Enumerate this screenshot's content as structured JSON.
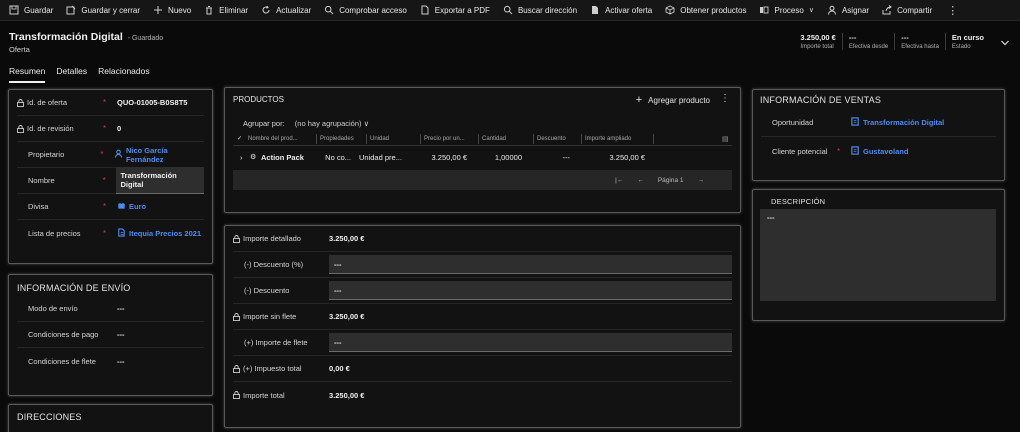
{
  "toolbar": {
    "items": [
      {
        "label": "Guardar",
        "icon": "save-icon"
      },
      {
        "label": "Guardar y cerrar",
        "icon": "save-close-icon"
      },
      {
        "label": "Nuevo",
        "icon": "plus-icon"
      },
      {
        "label": "Eliminar",
        "icon": "trash-icon"
      },
      {
        "label": "Actualizar",
        "icon": "refresh-icon"
      },
      {
        "label": "Comprobar acceso",
        "icon": "search-icon"
      },
      {
        "label": "Exportar a PDF",
        "icon": "export-icon"
      },
      {
        "label": "Buscar dirección",
        "icon": "search-icon"
      },
      {
        "label": "Activar oferta",
        "icon": "document-icon"
      },
      {
        "label": "Obtener productos",
        "icon": "box-icon"
      },
      {
        "label": "Proceso",
        "icon": "process-icon"
      },
      {
        "label": "Asignar",
        "icon": "person-icon"
      },
      {
        "label": "Compartir",
        "icon": "share-icon"
      }
    ],
    "more": "⋮"
  },
  "header": {
    "title": "Transformación Digital",
    "saved": "- Guardado",
    "entity": "Oferta",
    "fields": [
      {
        "value": "3.250,00 €",
        "label": "Importe total"
      },
      {
        "value": "---",
        "label": "Efectiva desde"
      },
      {
        "value": "---",
        "label": "Efectiva hasta"
      },
      {
        "value": "En curso",
        "label": "Estado"
      }
    ]
  },
  "tabs": [
    "Resumen",
    "Detalles",
    "Relacionados"
  ],
  "summary": {
    "fields": [
      {
        "label": "Id. de oferta",
        "value": "QUO-01005-B0S8T5",
        "locked": true,
        "required": true
      },
      {
        "label": "Id. de revisión",
        "value": "0",
        "locked": true,
        "required": true
      },
      {
        "label": "Propietario",
        "value": "Nico García Fernández",
        "required": true,
        "link": true,
        "icon": "person-icon"
      },
      {
        "label": "Nombre",
        "value": "Transformación Digital",
        "required": true,
        "boxed": true
      },
      {
        "label": "Divisa",
        "value": "Euro",
        "required": true,
        "link": true,
        "icon": "currency-icon"
      },
      {
        "label": "Lista de precios",
        "value": "Itequia Precios 2021",
        "required": true,
        "link": true,
        "icon": "pricelist-icon"
      }
    ]
  },
  "shipping": {
    "title": "INFORMACIÓN DE ENVÍO",
    "fields": [
      {
        "label": "Modo de envío",
        "value": "---"
      },
      {
        "label": "Condiciones de pago",
        "value": "---"
      },
      {
        "label": "Condiciones de flete",
        "value": "---"
      }
    ]
  },
  "addresses": {
    "title": "DIRECCIONES"
  },
  "products": {
    "title": "PRODUCTOS",
    "add_label": "Agregar producto",
    "group_label": "Agrupar por:",
    "group_value": "(no hay agrupación)",
    "columns": [
      "Nombre del prod...",
      "Propiedades",
      "Unidad",
      "Precio por un...",
      "Cantidad",
      "Descuento",
      "Importe ampliado"
    ],
    "rows": [
      {
        "name": "Action Pack",
        "properties": "No co...",
        "unit": "Unidad pre...",
        "price": "3.250,00 €",
        "quantity": "1,00000",
        "discount": "---",
        "amount": "3.250,00 €"
      }
    ],
    "page_label": "Página 1"
  },
  "totals": {
    "rows": [
      {
        "label": "Importe detallado",
        "value": "3.250,00 €",
        "locked": true
      },
      {
        "label": "(-) Descuento (%)",
        "value": "---",
        "boxed": true,
        "indent": true
      },
      {
        "label": "(-) Descuento",
        "value": "---",
        "boxed": true,
        "indent": true
      },
      {
        "label": "Importe sin flete",
        "value": "3.250,00 €",
        "locked": true
      },
      {
        "label": "(+) Importe de flete",
        "value": "---",
        "boxed": true,
        "indent": true
      },
      {
        "label": "(+) Impuesto total",
        "value": "0,00 €",
        "locked": true
      },
      {
        "label": "Importe total",
        "value": "3.250,00 €",
        "locked": true
      }
    ]
  },
  "sales": {
    "title": "INFORMACIÓN DE VENTAS",
    "fields": [
      {
        "label": "Oportunidad",
        "value": "Transformación Digital",
        "link": true
      },
      {
        "label": "Cliente potencial",
        "value": "Gustavoland",
        "link": true,
        "required": true
      }
    ]
  },
  "description": {
    "title": "DESCRIPCIÓN",
    "value": "---"
  },
  "colors": {
    "background": "#0a0a0a",
    "card": "#121212",
    "link": "#4c8cf0",
    "required": "#d23b3b"
  }
}
